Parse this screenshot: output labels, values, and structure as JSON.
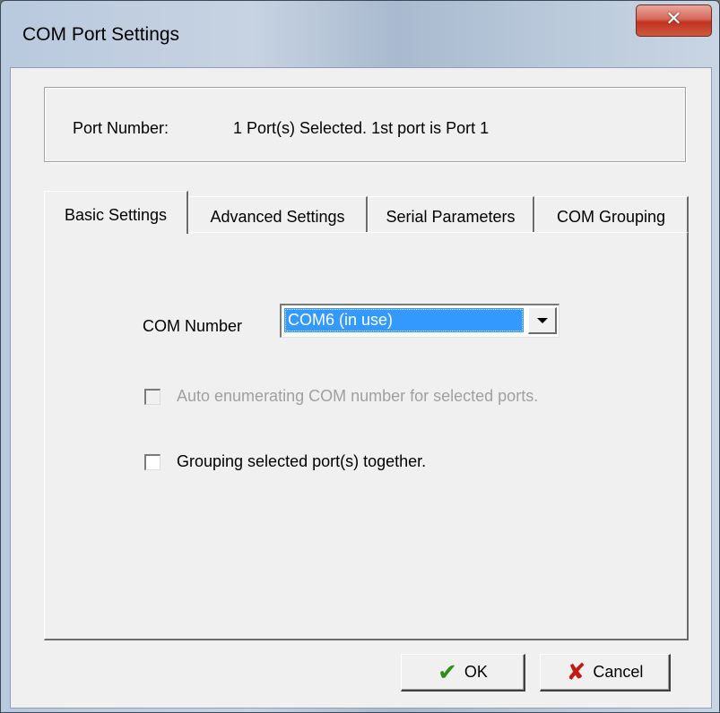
{
  "window": {
    "title": "COM Port Settings",
    "close_icon": "✕"
  },
  "port_info": {
    "label": "Port Number:",
    "value": "1 Port(s) Selected. 1st port is Port 1"
  },
  "tabs": [
    {
      "label": "Basic Settings",
      "active": true
    },
    {
      "label": "Advanced Settings",
      "active": false
    },
    {
      "label": "Serial Parameters",
      "active": false
    },
    {
      "label": "COM Grouping",
      "active": false
    }
  ],
  "basic": {
    "com_number_label": "COM Number",
    "com_number_value": "COM6 (in use)",
    "auto_enum_label": "Auto enumerating COM number for selected ports.",
    "auto_enum_checked": false,
    "auto_enum_enabled": false,
    "grouping_label": "Grouping selected port(s) together.",
    "grouping_checked": false
  },
  "buttons": {
    "ok_label": "OK",
    "ok_icon": "✔",
    "cancel_label": "Cancel",
    "cancel_icon": "✘"
  },
  "colors": {
    "selection": "#3399ff",
    "close_button": "#c7402b",
    "ok_icon": "#2f8f1a",
    "cancel_icon": "#c21b10"
  }
}
